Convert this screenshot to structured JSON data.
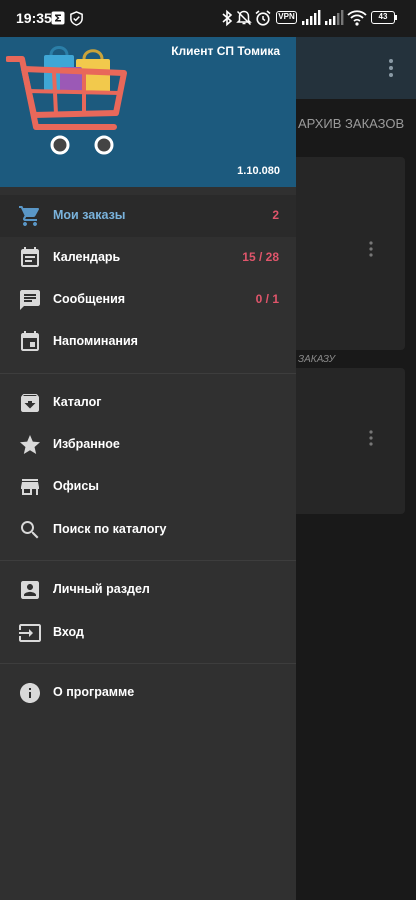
{
  "status_bar": {
    "time": "19:35",
    "vpn_label": "VPN",
    "battery": "43"
  },
  "background": {
    "tab_label": "АРХИВ ЗАКАЗОВ",
    "card_text": "ЗАКАЗУ"
  },
  "drawer": {
    "header": {
      "user_name": "Клиент СП Томика",
      "version": "1.10.080"
    },
    "sections": [
      [
        {
          "label": "Мои заказы",
          "count": "2",
          "icon": "cart-icon",
          "active": true
        },
        {
          "label": "Календарь",
          "count": "15 / 28",
          "icon": "calendar-icon"
        },
        {
          "label": "Сообщения",
          "count": "0 / 1",
          "icon": "message-icon"
        },
        {
          "label": "Напоминания",
          "count": "",
          "icon": "reminder-icon"
        }
      ],
      [
        {
          "label": "Каталог",
          "icon": "archive-icon"
        },
        {
          "label": "Избранное",
          "icon": "star-icon"
        },
        {
          "label": "Офисы",
          "icon": "store-icon"
        },
        {
          "label": "Поиск по каталогу",
          "icon": "search-icon"
        }
      ],
      [
        {
          "label": "Личный раздел",
          "icon": "account-box-icon"
        },
        {
          "label": "Вход",
          "icon": "login-icon"
        }
      ],
      [
        {
          "label": "О программе",
          "icon": "info-icon"
        }
      ]
    ]
  },
  "colors": {
    "header_bg": "#1c5a7e",
    "drawer_bg": "#303030",
    "active_label": "#7ab3dc",
    "count_accent": "#e0556b"
  }
}
